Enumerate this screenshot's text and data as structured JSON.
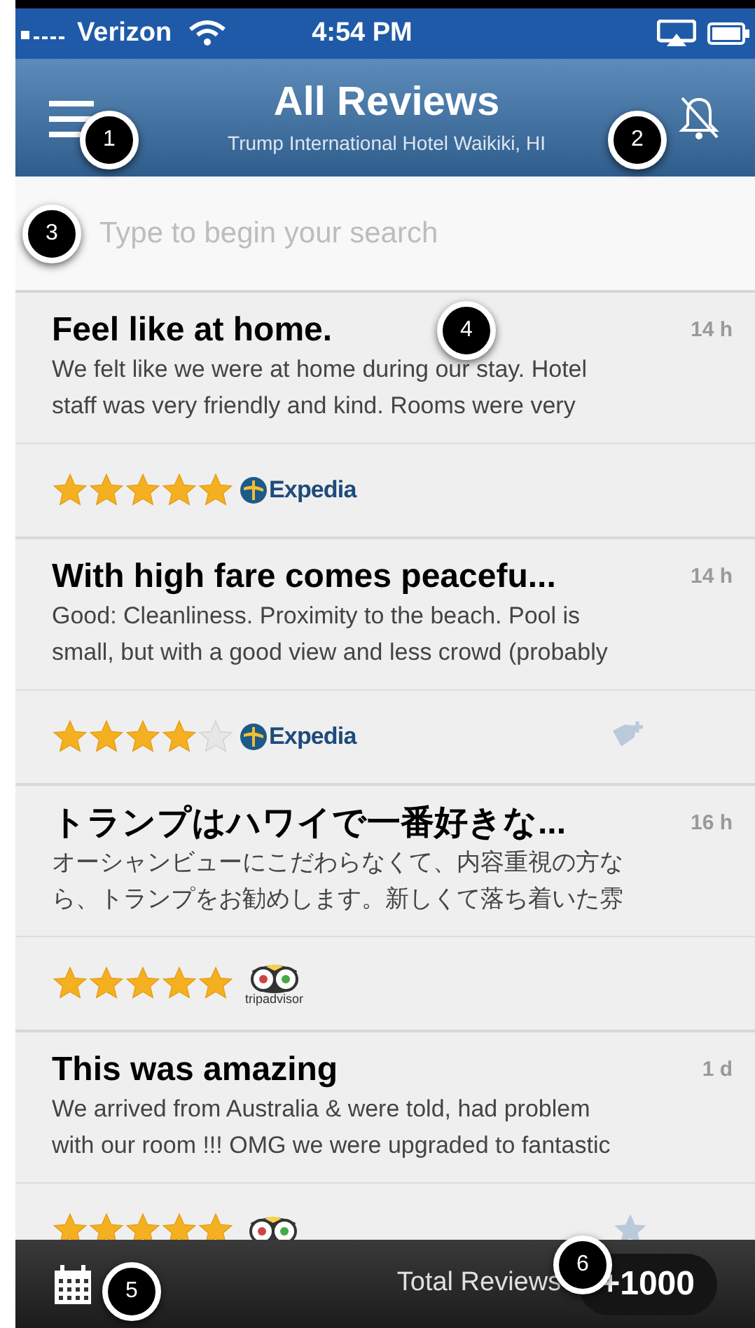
{
  "status_bar": {
    "carrier": "Verizon",
    "time": "4:54 PM"
  },
  "nav": {
    "title": "All Reviews",
    "subtitle": "Trump International Hotel Waikiki, HI"
  },
  "search": {
    "placeholder": "Type to begin your search"
  },
  "reviews": [
    {
      "title": "Feel like at home.",
      "age": "14 h",
      "lines": [
        "We felt like we were at home during our stay. Hotel",
        "staff was very friendly and kind. Rooms were very"
      ],
      "stars": 5,
      "source": {
        "kind": "expedia",
        "name": "Expedia"
      }
    },
    {
      "title": "With high fare comes peacefu...",
      "age": "14 h",
      "lines": [
        "Good: Cleanliness. Proximity to the beach. Pool is",
        "small, but with a good view and less crowd (probably"
      ],
      "stars": 4,
      "source": {
        "kind": "expedia",
        "name": "Expedia"
      },
      "action": {
        "kind": "tag"
      }
    },
    {
      "title": "トランプはハワイで一番好きな...",
      "age": "16 h",
      "lines": [
        "オーシャンビューにこだわらなくて、内容重視の方な",
        "ら、トランプをお勧めします。新しくて落ち着いた雰"
      ],
      "stars": 5,
      "source": {
        "kind": "tripadvisor",
        "name": "tripadvisor"
      }
    },
    {
      "title": "This was amazing",
      "age": "1 d",
      "lines": [
        "We arrived from Australia & were told, had problem",
        "with our room !!! OMG we were upgraded to fantastic"
      ],
      "stars": 5,
      "source": {
        "kind": "tripadvisor"
      },
      "action": {
        "kind": "star"
      }
    }
  ],
  "footer": {
    "label": "Total Reviews",
    "count": "+1000"
  },
  "callouts": [
    "1",
    "2",
    "3",
    "4",
    "5",
    "6"
  ]
}
